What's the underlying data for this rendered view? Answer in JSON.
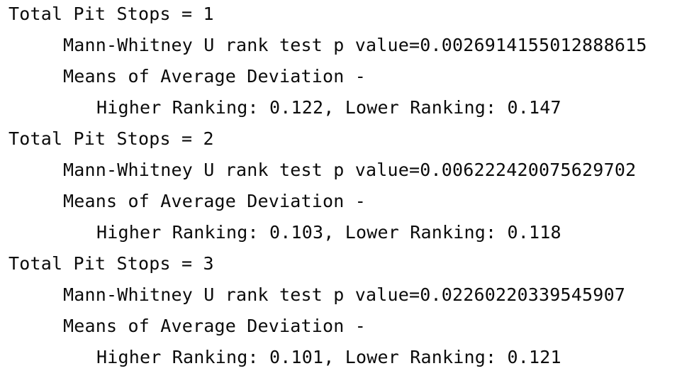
{
  "output": {
    "groups": [
      {
        "header": "Total Pit Stops = 1",
        "p_value_line": "Mann-Whitney U rank test p value=0.002691415501288861​5",
        "means_line": "Means of Average Deviation -",
        "ranking_line": "Higher Ranking: 0.122, Lower Ranking: 0.147"
      },
      {
        "header": "Total Pit Stops = 2",
        "p_value_line": "Mann-Whitney U rank test p value=0.006222420075629702",
        "means_line": "Means of Average Deviation -",
        "ranking_line": "Higher Ranking: 0.103, Lower Ranking: 0.118"
      },
      {
        "header": "Total Pit Stops = 3",
        "p_value_line": "Mann-Whitney U rank test p value=0.02260220339545907",
        "means_line": "Means of Average Deviation -",
        "ranking_line": "Higher Ranking: 0.101, Lower Ranking: 0.121"
      }
    ]
  }
}
